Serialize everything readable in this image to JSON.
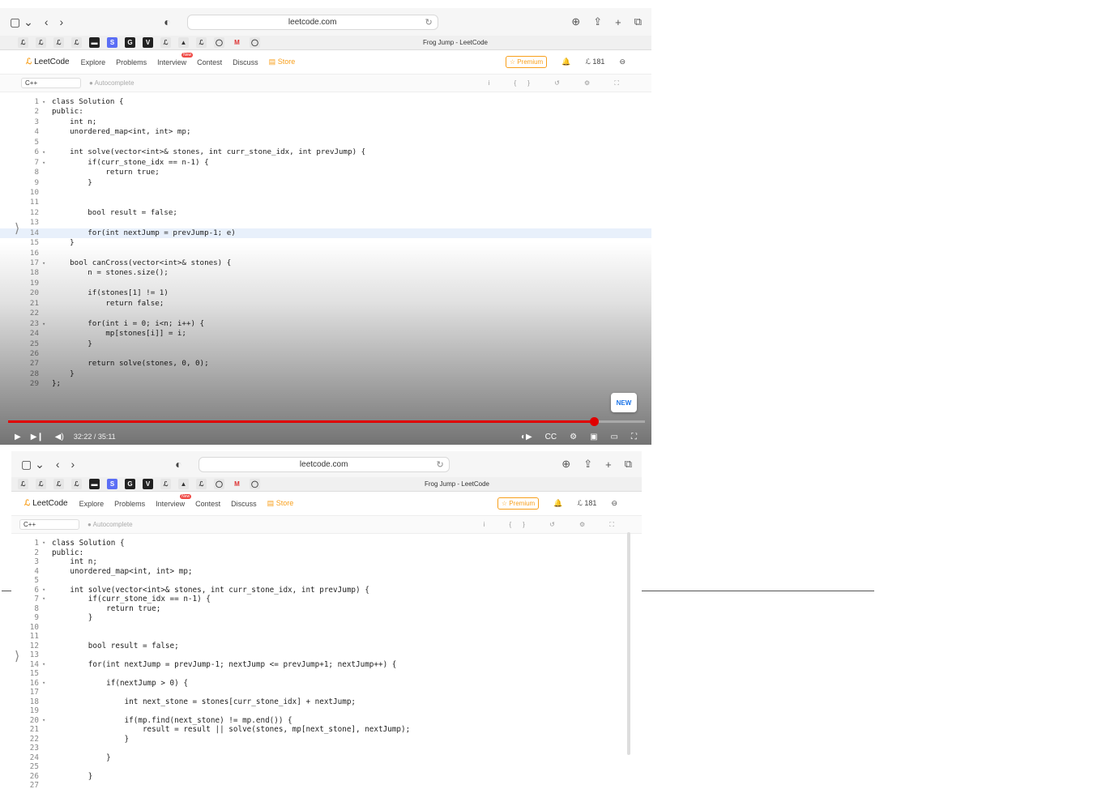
{
  "browser": {
    "url": "leetcode.com",
    "tab_title": "Frog Jump - LeetCode",
    "sidebar_icon": "▢ ⌄",
    "back": "‹",
    "forward": "›",
    "shield": "◐",
    "reload": "↻",
    "download": "⊕",
    "share": "⇪",
    "new_tab": "+",
    "tabs": "⧉"
  },
  "favorites": [
    "ℒ",
    "ℒ",
    "ℒ",
    "ℒ",
    "▬",
    "S",
    "G",
    "V",
    "ℒ",
    "▲",
    "ℒ",
    "◯",
    "M",
    "◯"
  ],
  "leetcode_nav": {
    "logo": "LeetCode",
    "items": [
      "Explore",
      "Problems",
      "Interview",
      "Contest",
      "Discuss"
    ],
    "new_badge": "New",
    "store": "Store",
    "premium": "☆ Premium",
    "bell": "🔔",
    "streak": "181"
  },
  "editor": {
    "language": "C++",
    "autocomplete": "● Autocomplete",
    "toolbar_icons": "i {} ↺ ⚙ ⛶"
  },
  "video": {
    "time": "32:22 / 35:11",
    "new_label": "NEW",
    "progress_fraction": 0.92
  },
  "code_top": [
    {
      "n": "1",
      "f": "▾",
      "t": "class Solution {"
    },
    {
      "n": "2",
      "f": "",
      "t": "public:"
    },
    {
      "n": "3",
      "f": "",
      "t": "    int n;"
    },
    {
      "n": "4",
      "f": "",
      "t": "    unordered_map<int, int> mp;"
    },
    {
      "n": "5",
      "f": "",
      "t": ""
    },
    {
      "n": "6",
      "f": "▾",
      "t": "    int solve(vector<int>& stones, int curr_stone_idx, int prevJump) {"
    },
    {
      "n": "7",
      "f": "▾",
      "t": "        if(curr_stone_idx == n-1) {"
    },
    {
      "n": "8",
      "f": "",
      "t": "            return true;"
    },
    {
      "n": "9",
      "f": "",
      "t": "        }"
    },
    {
      "n": "10",
      "f": "",
      "t": ""
    },
    {
      "n": "11",
      "f": "",
      "t": ""
    },
    {
      "n": "12",
      "f": "",
      "t": "        bool result = false;"
    },
    {
      "n": "13",
      "f": "",
      "t": ""
    },
    {
      "n": "14",
      "f": "",
      "t": "        for(int nextJump = prevJump-1; e)"
    },
    {
      "n": "15",
      "f": "",
      "t": "    }"
    },
    {
      "n": "16",
      "f": "",
      "t": ""
    },
    {
      "n": "17",
      "f": "▾",
      "t": "    bool canCross(vector<int>& stones) {"
    },
    {
      "n": "18",
      "f": "",
      "t": "        n = stones.size();"
    },
    {
      "n": "19",
      "f": "",
      "t": ""
    },
    {
      "n": "20",
      "f": "",
      "t": "        if(stones[1] != 1)"
    },
    {
      "n": "21",
      "f": "",
      "t": "            return false;"
    },
    {
      "n": "22",
      "f": "",
      "t": ""
    },
    {
      "n": "23",
      "f": "▾",
      "t": "        for(int i = 0; i<n; i++) {"
    },
    {
      "n": "24",
      "f": "",
      "t": "            mp[stones[i]] = i;"
    },
    {
      "n": "25",
      "f": "",
      "t": "        }"
    },
    {
      "n": "26",
      "f": "",
      "t": ""
    },
    {
      "n": "27",
      "f": "",
      "t": "        return solve(stones, 0, 0);"
    },
    {
      "n": "28",
      "f": "",
      "t": "    }"
    },
    {
      "n": "29",
      "f": "",
      "t": "};"
    }
  ],
  "code_bottom": [
    {
      "n": "1",
      "f": "▾",
      "t": "class Solution {"
    },
    {
      "n": "2",
      "f": "",
      "t": "public:"
    },
    {
      "n": "3",
      "f": "",
      "t": "    int n;"
    },
    {
      "n": "4",
      "f": "",
      "t": "    unordered_map<int, int> mp;"
    },
    {
      "n": "5",
      "f": "",
      "t": ""
    },
    {
      "n": "6",
      "f": "▾",
      "t": "    int solve(vector<int>& stones, int curr_stone_idx, int prevJump) {"
    },
    {
      "n": "7",
      "f": "▾",
      "t": "        if(curr_stone_idx == n-1) {"
    },
    {
      "n": "8",
      "f": "",
      "t": "            return true;"
    },
    {
      "n": "9",
      "f": "",
      "t": "        }"
    },
    {
      "n": "10",
      "f": "",
      "t": ""
    },
    {
      "n": "11",
      "f": "",
      "t": ""
    },
    {
      "n": "12",
      "f": "",
      "t": "        bool result = false;"
    },
    {
      "n": "13",
      "f": "",
      "t": ""
    },
    {
      "n": "14",
      "f": "▾",
      "t": "        for(int nextJump = prevJump-1; nextJump <= prevJump+1; nextJump++) {"
    },
    {
      "n": "15",
      "f": "",
      "t": ""
    },
    {
      "n": "16",
      "f": "▾",
      "t": "            if(nextJump > 0) {"
    },
    {
      "n": "17",
      "f": "",
      "t": ""
    },
    {
      "n": "18",
      "f": "",
      "t": "                int next_stone = stones[curr_stone_idx] + nextJump;"
    },
    {
      "n": "19",
      "f": "",
      "t": ""
    },
    {
      "n": "20",
      "f": "▾",
      "t": "                if(mp.find(next_stone) != mp.end()) {"
    },
    {
      "n": "21",
      "f": "",
      "t": "                    result = result || solve(stones, mp[next_stone], nextJump);"
    },
    {
      "n": "22",
      "f": "",
      "t": "                }"
    },
    {
      "n": "23",
      "f": "",
      "t": ""
    },
    {
      "n": "24",
      "f": "",
      "t": "            }"
    },
    {
      "n": "25",
      "f": "",
      "t": ""
    },
    {
      "n": "26",
      "f": "",
      "t": "        }"
    },
    {
      "n": "27",
      "f": "",
      "t": ""
    }
  ]
}
